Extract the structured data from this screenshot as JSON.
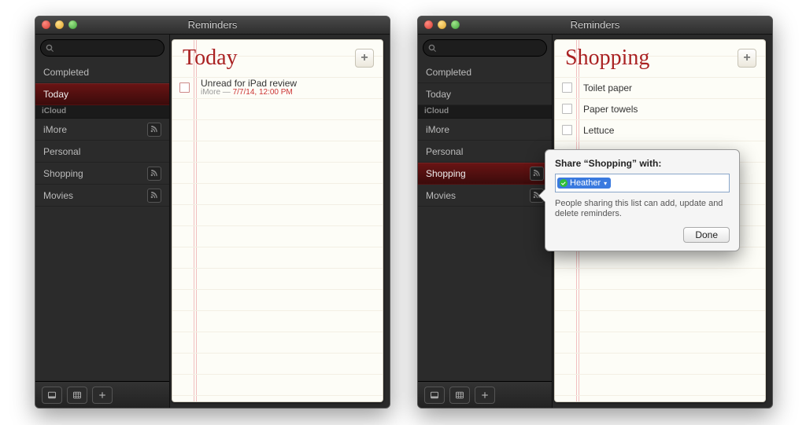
{
  "app_title": "Reminders",
  "traffic_lights": [
    "close",
    "minimize",
    "zoom"
  ],
  "left_window": {
    "sidebar": {
      "items": [
        {
          "label": "Completed",
          "type": "item",
          "share_icon": false,
          "selected": false
        },
        {
          "label": "Today",
          "type": "item",
          "share_icon": false,
          "selected": true
        },
        {
          "label": "iCloud",
          "type": "section"
        },
        {
          "label": "iMore",
          "type": "item",
          "share_icon": true,
          "selected": false
        },
        {
          "label": "Personal",
          "type": "item",
          "share_icon": false,
          "selected": false
        },
        {
          "label": "Shopping",
          "type": "item",
          "share_icon": true,
          "selected": false
        },
        {
          "label": "Movies",
          "type": "item",
          "share_icon": true,
          "selected": false
        }
      ]
    },
    "list_title": "Today",
    "reminders": [
      {
        "title": "Unread for iPad review",
        "source": "iMore",
        "due": "7/7/14, 12:00 PM"
      }
    ]
  },
  "right_window": {
    "sidebar": {
      "items": [
        {
          "label": "Completed",
          "type": "item",
          "share_icon": false,
          "selected": false
        },
        {
          "label": "Today",
          "type": "item",
          "share_icon": false,
          "selected": false
        },
        {
          "label": "iCloud",
          "type": "section"
        },
        {
          "label": "iMore",
          "type": "item",
          "share_icon": false,
          "selected": false
        },
        {
          "label": "Personal",
          "type": "item",
          "share_icon": false,
          "selected": false
        },
        {
          "label": "Shopping",
          "type": "item",
          "share_icon": true,
          "selected": true
        },
        {
          "label": "Movies",
          "type": "item",
          "share_icon": true,
          "selected": false
        }
      ]
    },
    "list_title": "Shopping",
    "reminders": [
      {
        "title": "Toilet paper"
      },
      {
        "title": "Paper towels"
      },
      {
        "title": "Lettuce"
      }
    ],
    "share_popover": {
      "title": "Share “Shopping” with:",
      "token": "Heather",
      "hint": "People sharing this list can add, update and delete reminders.",
      "done_label": "Done"
    }
  }
}
